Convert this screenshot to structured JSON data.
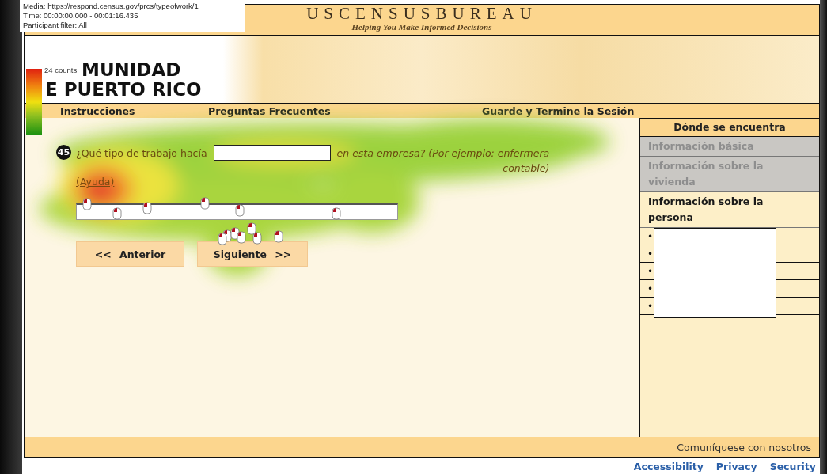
{
  "overlay": {
    "info_lines": [
      "Media: https://respond.census.gov/prcs/typeofwork/1",
      "Time: 00:00:00.000 - 00:01:16.435",
      "Participant filter: All"
    ],
    "legend_label": "24 counts"
  },
  "header": {
    "logo": "USCENSUSBUREAU",
    "tagline": "Helping You Make Informed Decisions"
  },
  "banner": {
    "title_lines": [
      "MUNIDAD",
      "E PUERTO RICO"
    ]
  },
  "nav": [
    "Instrucciones",
    "Preguntas Frecuentes",
    "Guarde y Termine la Sesión"
  ],
  "question": {
    "number": "45",
    "text_start": "¿Qué tipo de trabajo hacía",
    "text_end": "en esta empresa? (Por ejemplo: enfermera",
    "text_line_2": "contable)",
    "help": "(Ayuda)"
  },
  "buttons": [
    "<< Anterior",
    "Siguiente >>"
  ],
  "sidebar": {
    "title": "Dónde se encuentra",
    "items": [
      {
        "label": "Información básica",
        "completed": true
      },
      {
        "label": "Información sobre la vivienda",
        "completed": true
      },
      {
        "label": "Información sobre la persona",
        "completed": false
      }
    ],
    "sub_items": [
      "•",
      "•",
      "•",
      "•",
      "•"
    ]
  },
  "footer": {
    "contact": "Comuníquese con nosotros"
  },
  "links": [
    "Accessibility",
    "Privacy",
    "Security"
  ]
}
